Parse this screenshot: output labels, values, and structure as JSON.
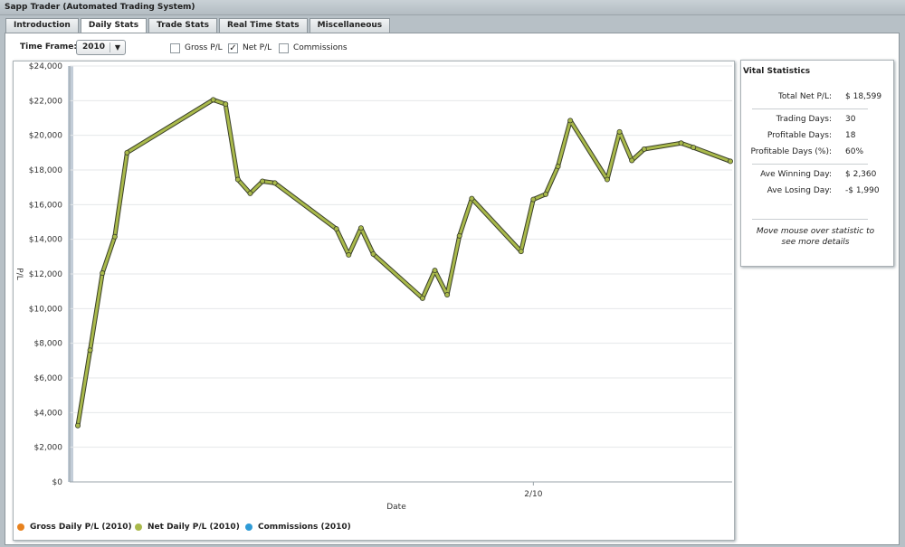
{
  "window": {
    "title": "Sapp Trader (Automated Trading System)"
  },
  "tabs": [
    {
      "label": "Introduction"
    },
    {
      "label": "Daily Stats"
    },
    {
      "label": "Trade Stats"
    },
    {
      "label": "Real Time Stats"
    },
    {
      "label": "Miscellaneous"
    }
  ],
  "active_tab": "Daily Stats",
  "controls": {
    "timeframe_label": "Time Frame:",
    "timeframe_value": "2010",
    "gross_label": "Gross P/L",
    "gross_checked": false,
    "net_label": "Net P/L",
    "net_checked": true,
    "commissions_label": "Commissions",
    "commissions_checked": false
  },
  "stats": {
    "title": "Vital Statistics",
    "total_net_label": "Total Net P/L:",
    "total_net_value": "$ 18,599",
    "trading_days_label": "Trading Days:",
    "trading_days_value": "30",
    "profitable_days_label": "Profitable Days:",
    "profitable_days_value": "18",
    "profitable_pct_label": "Profitable Days (%):",
    "profitable_pct_value": "60%",
    "ave_win_label": "Ave Winning Day:",
    "ave_win_value": "$ 2,360",
    "ave_lose_label": "Ave Losing Day:",
    "ave_lose_value": "-$ 1,990",
    "hint": "Move mouse over statistic to see more details"
  },
  "legend": [
    {
      "label": "Gross Daily P/L (2010)",
      "color": "#e8821e"
    },
    {
      "label": "Net Daily P/L (2010)",
      "color": "#a9b94b"
    },
    {
      "label": "Commissions (2010)",
      "color": "#2f9bd6"
    }
  ],
  "chart_data": {
    "type": "line",
    "xlabel": "Date",
    "ylabel": "P/L",
    "x_tick_labels": [
      "2/10"
    ],
    "y_tick_labels": [
      "$0",
      "$2,000",
      "$4,000",
      "$6,000",
      "$8,000",
      "$10,000",
      "$12,000",
      "$14,000",
      "$16,000",
      "$18,000",
      "$20,000",
      "$22,000",
      "$24,000"
    ],
    "ylim": [
      0,
      24000
    ],
    "grid": true,
    "series": [
      {
        "name": "Net Daily P/L (2010)",
        "color": "#a9b94b",
        "x": [
          "1/4",
          "1/5",
          "1/6",
          "1/7",
          "1/8",
          "1/15",
          "1/16",
          "1/17",
          "1/18",
          "1/19",
          "1/20",
          "1/25",
          "1/26",
          "1/27",
          "1/28",
          "2/1",
          "2/2",
          "2/3",
          "2/4",
          "2/5",
          "2/9",
          "2/10",
          "2/11",
          "2/12",
          "2/13",
          "2/16",
          "2/17",
          "2/18",
          "2/19",
          "2/22",
          "2/23",
          "2/26"
        ],
        "values": [
          3250,
          7600,
          12050,
          14150,
          19000,
          22050,
          21800,
          17450,
          16650,
          17350,
          17250,
          14600,
          13100,
          14650,
          13150,
          10600,
          12200,
          10800,
          14200,
          16350,
          13300,
          16300,
          16600,
          18200,
          20850,
          17450,
          20200,
          18550,
          19200,
          19550,
          19300,
          18500
        ]
      }
    ]
  }
}
